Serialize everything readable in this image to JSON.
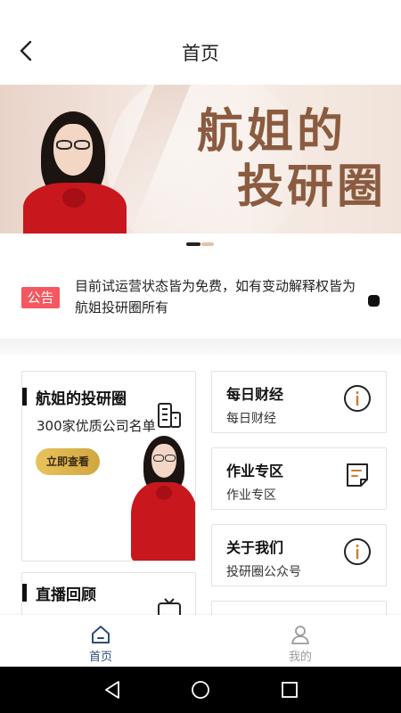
{
  "header": {
    "title": "首页",
    "back_icon": "chevron-left-icon"
  },
  "banner": {
    "title_line1": "航姐的",
    "title_line2": "投研圈",
    "slide_index": 1,
    "slide_count": 2
  },
  "notice": {
    "badge": "公告",
    "text": "目前试运营状态皆为免费，如有变动解释权皆为航姐投研圈所有"
  },
  "cards": {
    "featured": {
      "title": "航姐的投研圈",
      "subtitle": "300家优质公司名单",
      "button": "立即查看",
      "icon": "building-icon"
    },
    "live": {
      "title": "直播回顾",
      "icon": "tv-icon"
    },
    "right": [
      {
        "title": "每日财经",
        "subtitle": "每日财经",
        "icon": "info-icon"
      },
      {
        "title": "作业专区",
        "subtitle": "作业专区",
        "icon": "note-icon"
      },
      {
        "title": "关于我们",
        "subtitle": "投研圈公众号",
        "icon": "info-icon"
      }
    ]
  },
  "tabbar": {
    "home": {
      "label": "首页",
      "icon": "home-icon",
      "active": true
    },
    "mine": {
      "label": "我的",
      "icon": "user-icon",
      "active": false
    }
  },
  "colors": {
    "notice_badge": "#f4575f",
    "active_tab": "#2d4b7a",
    "banner_title": "#8b5b40",
    "cta_button": "#d9b04a",
    "dress_red": "#c8171d"
  }
}
